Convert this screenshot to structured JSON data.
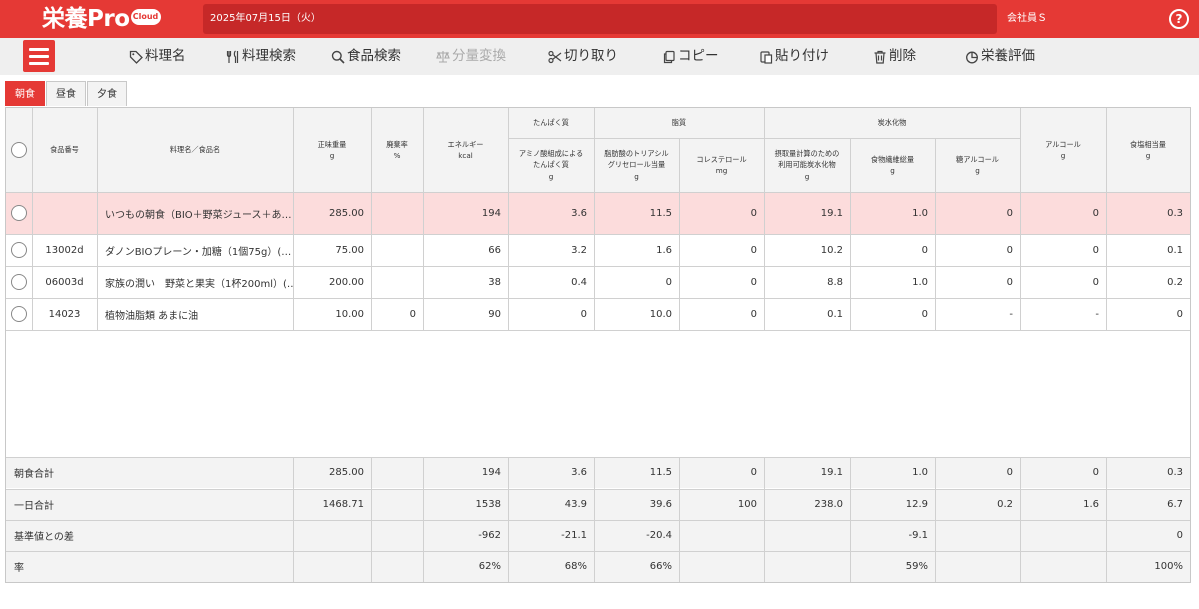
{
  "app": {
    "logo_main": "栄養Pro",
    "logo_badge": "Cloud",
    "date": "2025年07月15日（火）",
    "user": "会社員Ｓ",
    "help": "?"
  },
  "toolbar": [
    {
      "label": "料理名",
      "icon": "tag-icon",
      "disabled": false
    },
    {
      "label": "料理検索",
      "icon": "utensils-icon",
      "disabled": false
    },
    {
      "label": "食品検索",
      "icon": "search-icon",
      "disabled": false
    },
    {
      "label": "分量変換",
      "icon": "scale-icon",
      "disabled": true
    },
    {
      "label": "切り取り",
      "icon": "scissors-icon",
      "disabled": false
    },
    {
      "label": "コピー",
      "icon": "copy-icon",
      "disabled": false
    },
    {
      "label": "貼り付け",
      "icon": "paste-icon",
      "disabled": false
    },
    {
      "label": "削除",
      "icon": "trash-icon",
      "disabled": false
    },
    {
      "label": "栄養評価",
      "icon": "pie-chart-icon",
      "disabled": false
    }
  ],
  "tabs": [
    {
      "label": "朝食",
      "active": true
    },
    {
      "label": "昼食",
      "active": false
    },
    {
      "label": "夕食",
      "active": false
    }
  ],
  "headers": {
    "food_no": "食品番号",
    "name": "料理名／食品名",
    "weight": [
      "正味重量",
      "g"
    ],
    "waste": [
      "廃棄率",
      "%"
    ],
    "energy": [
      "エネルギー",
      "kcal"
    ],
    "protein_group": "たんぱく質",
    "protein": [
      "アミノ酸組成による",
      "たんぱく質",
      "g"
    ],
    "fat_group": "脂質",
    "fat": [
      "脂肪酸のトリアシル",
      "グリセロール当量",
      "g"
    ],
    "chol": [
      "コレステロール",
      "mg"
    ],
    "carb_group": "炭水化物",
    "carb": [
      "摂取量計算のための",
      "利用可能炭水化物",
      "g"
    ],
    "fiber": [
      "食物繊維総量",
      "g"
    ],
    "sugaralc": [
      "糖アルコール",
      "g"
    ],
    "alcohol": [
      "アルコール",
      "g"
    ],
    "salt": [
      "食塩相当量",
      "g"
    ]
  },
  "rows": [
    {
      "no": "",
      "name": "いつもの朝食（BIO＋野菜ジュース＋あ…",
      "weight": "285.00",
      "waste": "",
      "energy": "194",
      "protein": "3.6",
      "fat": "11.5",
      "chol": "0",
      "carb": "19.1",
      "fiber": "1.0",
      "sugaralc": "0",
      "alcohol": "0",
      "salt": "0.3",
      "highlight": true
    },
    {
      "no": "13002d",
      "name": "ダノンBIOプレーン・加糖（1個75g）(…",
      "weight": "75.00",
      "waste": "",
      "energy": "66",
      "protein": "3.2",
      "fat": "1.6",
      "chol": "0",
      "carb": "10.2",
      "fiber": "0",
      "sugaralc": "0",
      "alcohol": "0",
      "salt": "0.1",
      "highlight": false
    },
    {
      "no": "06003d",
      "name": "家族の潤い　野菜と果実（1杯200ml）(…",
      "weight": "200.00",
      "waste": "",
      "energy": "38",
      "protein": "0.4",
      "fat": "0",
      "chol": "0",
      "carb": "8.8",
      "fiber": "1.0",
      "sugaralc": "0",
      "alcohol": "0",
      "salt": "0.2",
      "highlight": false
    },
    {
      "no": "14023",
      "name": "植物油脂類 あまに油",
      "weight": "10.00",
      "waste": "0",
      "energy": "90",
      "protein": "0",
      "fat": "10.0",
      "chol": "0",
      "carb": "0.1",
      "fiber": "0",
      "sugaralc": "-",
      "alcohol": "-",
      "salt": "0",
      "highlight": false
    }
  ],
  "summary": [
    {
      "label": "朝食合計",
      "weight": "285.00",
      "waste": "",
      "energy": "194",
      "protein": "3.6",
      "fat": "11.5",
      "chol": "0",
      "carb": "19.1",
      "fiber": "1.0",
      "sugaralc": "0",
      "alcohol": "0",
      "salt": "0.3"
    },
    {
      "label": "一日合計",
      "weight": "1468.71",
      "waste": "",
      "energy": "1538",
      "protein": "43.9",
      "fat": "39.6",
      "chol": "100",
      "carb": "238.0",
      "fiber": "12.9",
      "sugaralc": "0.2",
      "alcohol": "1.6",
      "salt": "6.7"
    },
    {
      "label": "基準値との差",
      "weight": "",
      "waste": "",
      "energy": "-962",
      "protein": "-21.1",
      "fat": "-20.4",
      "chol": "",
      "carb": "",
      "fiber": "-9.1",
      "sugaralc": "",
      "alcohol": "",
      "salt": "0"
    },
    {
      "label": "率",
      "weight": "",
      "waste": "",
      "energy": "62%",
      "protein": "68%",
      "fat": "66%",
      "chol": "",
      "carb": "",
      "fiber": "59%",
      "sugaralc": "",
      "alcohol": "",
      "salt": "100%"
    }
  ],
  "colors": {
    "brand": "#e53935",
    "date_bar": "#c62828",
    "highlight_row": "#fcdcdc",
    "summary_bg": "#f3f3f3"
  }
}
